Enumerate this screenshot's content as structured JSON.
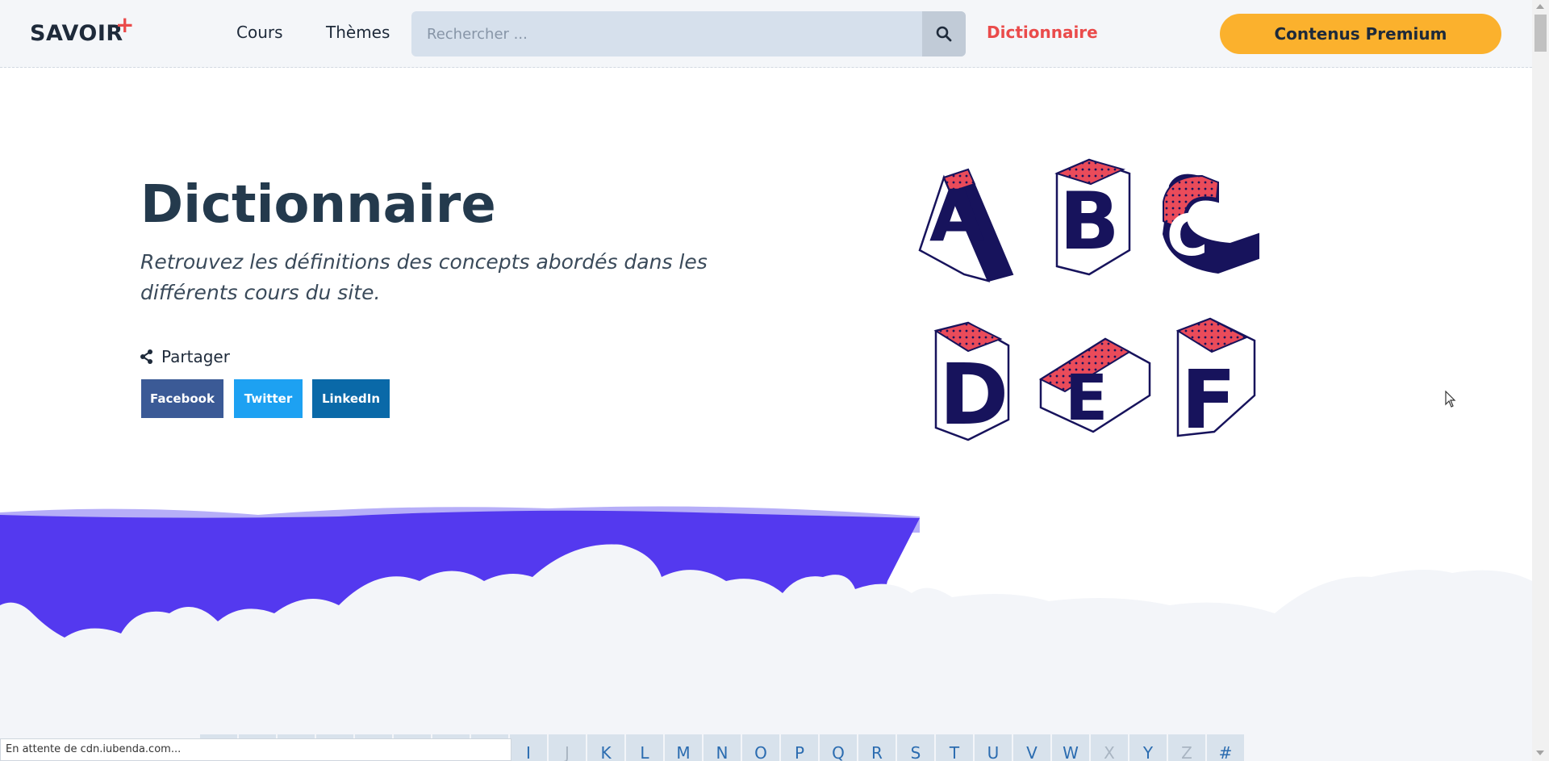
{
  "header": {
    "logo": "SAVOIR",
    "logo_plus": "+",
    "nav": [
      "Cours",
      "Thèmes"
    ],
    "search_placeholder": "Rechercher ...",
    "dictionary_link": "Dictionnaire",
    "premium_button": "Contenus Premium"
  },
  "hero": {
    "title": "Dictionnaire",
    "subtitle": "Retrouvez les définitions des concepts abordés dans les différents cours du site.",
    "share_label": "Partager",
    "share_buttons": [
      "Facebook",
      "Twitter",
      "LinkedIn"
    ]
  },
  "illustration": {
    "letters": [
      "A",
      "B",
      "C",
      "D",
      "E",
      "F"
    ]
  },
  "alphabet": [
    {
      "label": "",
      "disabled": false
    },
    {
      "label": "",
      "disabled": false
    },
    {
      "label": "",
      "disabled": false
    },
    {
      "label": "",
      "disabled": false
    },
    {
      "label": "",
      "disabled": false
    },
    {
      "label": "",
      "disabled": false
    },
    {
      "label": "",
      "disabled": false
    },
    {
      "label": "",
      "disabled": false
    },
    {
      "label": "I",
      "disabled": false
    },
    {
      "label": "J",
      "disabled": true
    },
    {
      "label": "K",
      "disabled": false
    },
    {
      "label": "L",
      "disabled": false
    },
    {
      "label": "M",
      "disabled": false
    },
    {
      "label": "N",
      "disabled": false
    },
    {
      "label": "O",
      "disabled": false
    },
    {
      "label": "P",
      "disabled": false
    },
    {
      "label": "Q",
      "disabled": false
    },
    {
      "label": "R",
      "disabled": false
    },
    {
      "label": "S",
      "disabled": false
    },
    {
      "label": "T",
      "disabled": false
    },
    {
      "label": "U",
      "disabled": false
    },
    {
      "label": "V",
      "disabled": false
    },
    {
      "label": "W",
      "disabled": false
    },
    {
      "label": "X",
      "disabled": true
    },
    {
      "label": "Y",
      "disabled": false
    },
    {
      "label": "Z",
      "disabled": true
    },
    {
      "label": "#",
      "disabled": false
    }
  ],
  "status_bar": "En attente de cdn.iubenda.com...",
  "colors": {
    "accent_red": "#ea4b4b",
    "premium_yellow": "#fbb12d",
    "wave_purple": "#5439ef",
    "letter_navy": "#17135c"
  }
}
